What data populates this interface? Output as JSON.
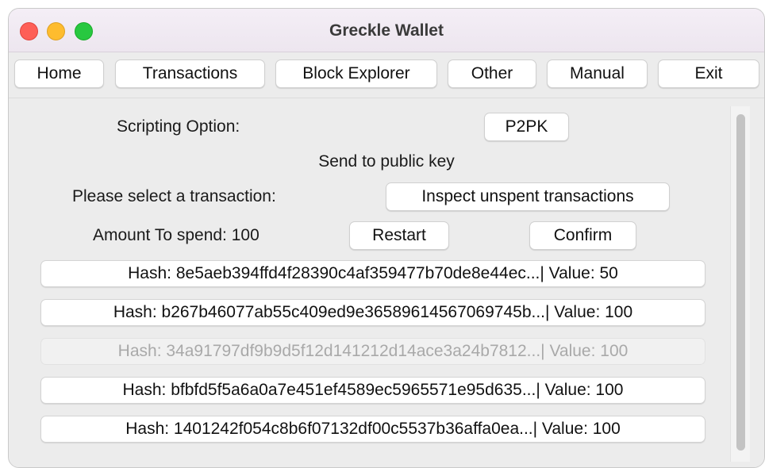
{
  "window": {
    "title": "Greckle Wallet"
  },
  "nav": {
    "items": [
      {
        "label": "Home"
      },
      {
        "label": "Transactions"
      },
      {
        "label": "Block Explorer"
      },
      {
        "label": "Other"
      },
      {
        "label": "Manual"
      },
      {
        "label": "Exit"
      }
    ]
  },
  "form": {
    "scripting_label": "Scripting Option:",
    "scripting_value": "P2PK",
    "scripting_description": "Send to public key",
    "select_label": "Please select a transaction:",
    "inspect_label": "Inspect unspent transactions",
    "amount_label": "Amount To spend: 100",
    "restart_label": "Restart",
    "confirm_label": "Confirm"
  },
  "transactions": [
    {
      "text": "Hash: 8e5aeb394ffd4f28390c4af359477b70de8e44ec...| Value: 50",
      "enabled": true
    },
    {
      "text": "Hash: b267b46077ab55c409ed9e36589614567069745b...| Value: 100",
      "enabled": true
    },
    {
      "text": "Hash: 34a91797df9b9d5f12d141212d14ace3a24b7812...| Value: 100",
      "enabled": false
    },
    {
      "text": "Hash: bfbfd5f5a6a0a7e451ef4589ec5965571e95d635...| Value: 100",
      "enabled": true
    },
    {
      "text": "Hash: 1401242f054c8b6f07132df00c5537b36affa0ea...| Value: 100",
      "enabled": true
    }
  ],
  "colors": {
    "close": "#fe5f57",
    "minimize": "#febc2e",
    "zoom": "#28c840",
    "window_bg": "#ececec",
    "disabled_text": "#a9a9a9"
  },
  "icons": {
    "close": "close-traffic-light-icon",
    "minimize": "minimize-traffic-light-icon",
    "zoom": "zoom-traffic-light-icon"
  }
}
